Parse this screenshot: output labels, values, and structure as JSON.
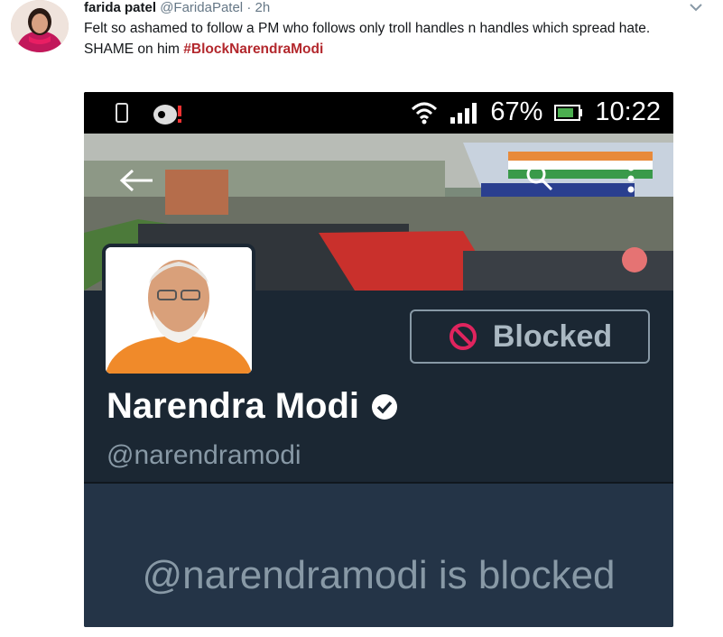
{
  "tweet": {
    "author_name": "farida patel",
    "author_handle": "@FaridaPatel",
    "separator": "·",
    "time": "2h",
    "line1": "Felt so ashamed to follow a PM who follows only troll handles n handles which spread hate.",
    "line2_prefix": "SHAME on him ",
    "hashtag": "#BlockNarendraModi",
    "caret_icon": "chevron-down-icon"
  },
  "phone": {
    "status_bar": {
      "battery_percent": "67%",
      "time": "10:22",
      "icons": [
        "phone-icon",
        "cast-icon",
        "wifi-icon",
        "signal-icon",
        "battery-icon"
      ]
    },
    "cover": {
      "icons": [
        "back-arrow-icon",
        "search-icon",
        "more-vertical-icon"
      ]
    },
    "profile": {
      "blocked_label": "Blocked",
      "display_name": "Narendra Modi",
      "screen_name": "@narendramodi",
      "blocked_message": "@narendramodi is blocked"
    }
  },
  "colors": {
    "hashtag": "#b3282d",
    "profile_bg": "#1b2733",
    "blocked_icon": "#e0245e"
  }
}
